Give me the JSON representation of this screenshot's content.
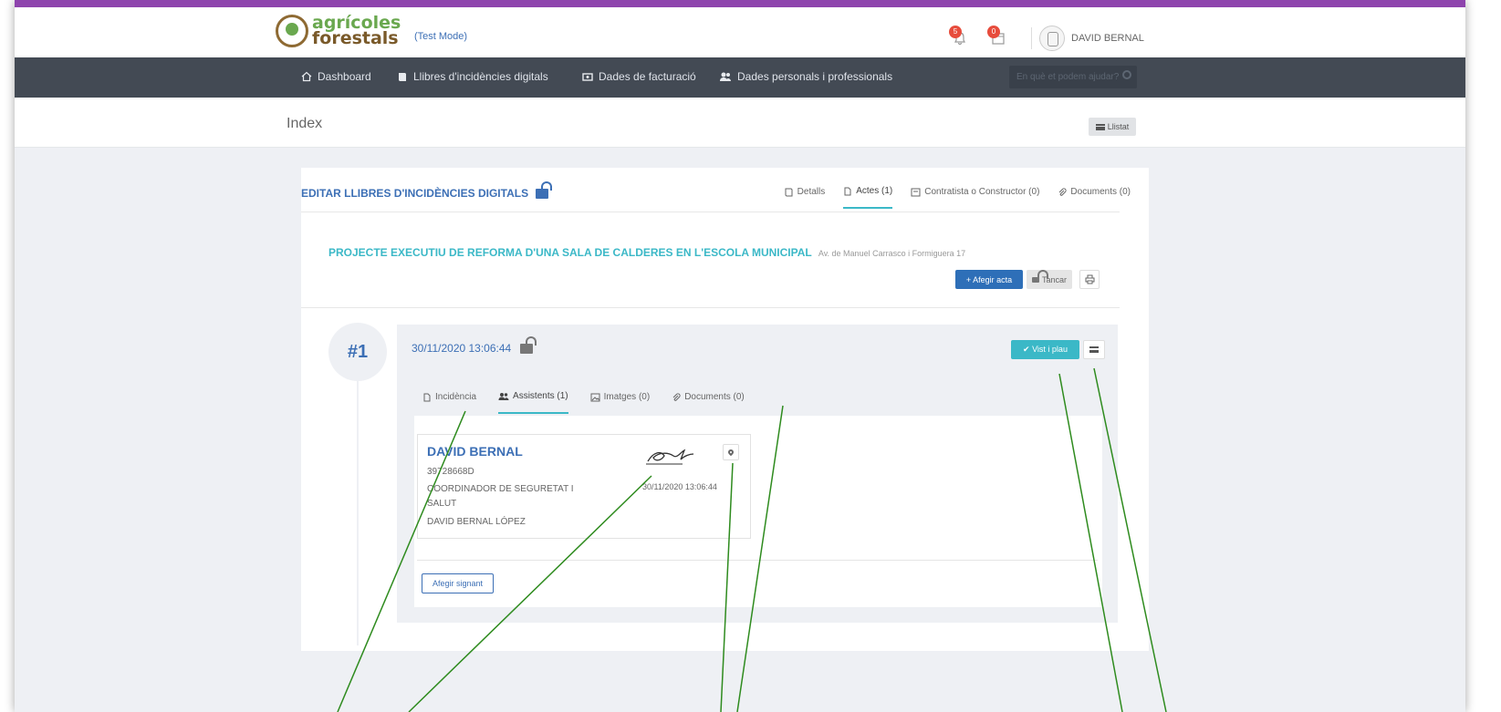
{
  "header": {
    "logo_line1": "agrícoles",
    "logo_line2": "forestals",
    "test_mode": "(Test Mode)",
    "notif_bell_count": "5",
    "notif_calendar_count": "0",
    "user_name": "DAVID BERNAL"
  },
  "nav": {
    "items": [
      {
        "label": "Dashboard",
        "icon": "home-icon"
      },
      {
        "label": "Llibres d'incidències digitals",
        "icon": "book-icon"
      },
      {
        "label": "Dades de facturació",
        "icon": "card-icon"
      },
      {
        "label": "Dades personals i professionals",
        "icon": "users-icon"
      }
    ],
    "search_placeholder": "En què et podem ajudar?"
  },
  "page": {
    "title": "Index",
    "listat_label": "Llistat"
  },
  "panel": {
    "title": "EDITAR LLIBRES D'INCIDÈNCIES DIGITALS",
    "tabs": [
      {
        "label": "Detalls",
        "icon": "book-icon"
      },
      {
        "label": "Actes (1)",
        "icon": "file-icon",
        "active": true
      },
      {
        "label": "Contratista o Constructor (0)",
        "icon": "id-card-icon"
      },
      {
        "label": "Documents (0)",
        "icon": "paperclip-icon"
      }
    ],
    "project_title": "PROJECTE EXECUTIU DE REFORMA D'UNA SALA DE CALDERES EN L'ESCOLA MUNICIPAL",
    "project_address": "Av. de Manuel Carrasco i Formiguera 17",
    "add_acta_label": "+ Afegir acta",
    "close_label": "Tancar"
  },
  "acta": {
    "number": "#1",
    "datetime": "30/11/2020 13:06:44",
    "approve_label": "✔ Vist i plau",
    "tabs": [
      {
        "label": "Incidència",
        "icon": "file-icon"
      },
      {
        "label": "Assistents (1)",
        "icon": "users-icon",
        "active": true
      },
      {
        "label": "Imatges (0)",
        "icon": "image-icon"
      },
      {
        "label": "Documents (0)",
        "icon": "paperclip-icon"
      }
    ],
    "assistant": {
      "name": "DAVID BERNAL",
      "id": "39728668D",
      "role_line1": "COORDINADOR DE SEGURETAT I",
      "role_line2": "SALUT",
      "full_name": "DAVID BERNAL LÓPEZ",
      "sign_date": "30/11/2020 13:06:44"
    },
    "add_signer_label": "Afegir signant"
  },
  "colors": {
    "accent_purple": "#8e44ad",
    "nav_bg": "#434a54",
    "primary_blue": "#3c6fb5",
    "teal": "#3bb8c7",
    "annotation_green": "#2e8b1e"
  }
}
